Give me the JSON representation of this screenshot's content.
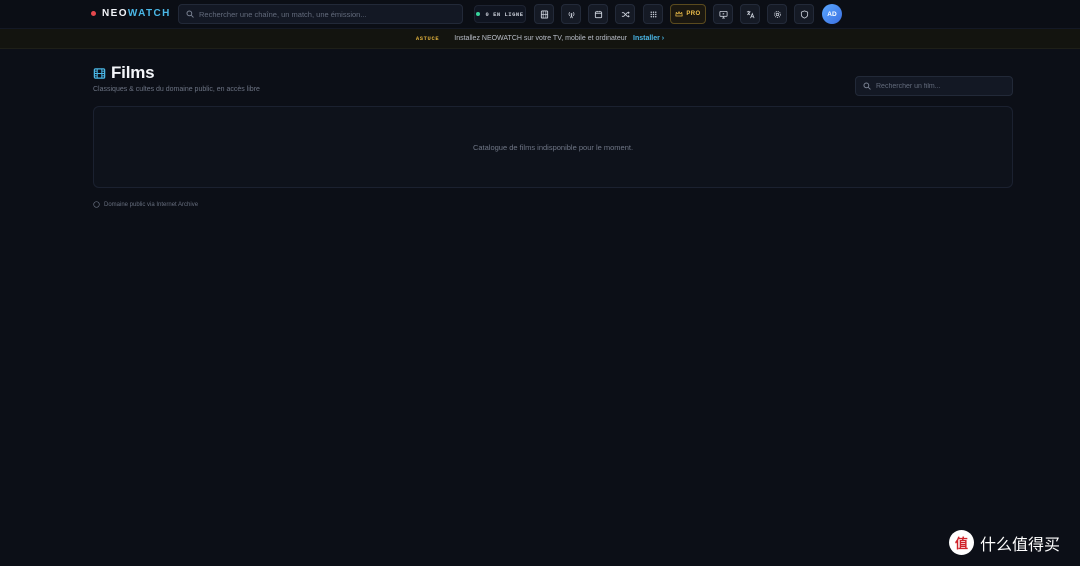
{
  "app": {
    "logo_part1": "NEO",
    "logo_part2": "WATCH",
    "accent_color": "#4ab7e6",
    "live_dot_color": "#37d39a",
    "pro_color": "#f1c14b"
  },
  "header": {
    "search_placeholder": "Rechercher une chaîne, un match, une émission...",
    "live_label": "0 EN LIGNE",
    "pro_label": "PRO",
    "avatar_initials": "AD",
    "icons": [
      "film-icon",
      "broadcast-icon",
      "calendar-icon",
      "shuffle-icon",
      "grid-icon",
      "crown-icon",
      "tv-icon",
      "translate-icon",
      "settings-icon",
      "shield-icon"
    ]
  },
  "tip": {
    "tag": "ASTUCE",
    "message": "Installez NEOWATCH sur votre TV, mobile et ordinateur",
    "link": "Installer ›"
  },
  "main": {
    "title": "Films",
    "subtitle": "Classiques & cultes du domaine public, en accès libre",
    "search_placeholder": "Rechercher un film...",
    "empty_message": "Catalogue de films indisponible pour le moment.",
    "footer_note": "Domaine public via Internet Archive"
  },
  "watermark": {
    "badge": "值",
    "text": "什么值得买"
  }
}
